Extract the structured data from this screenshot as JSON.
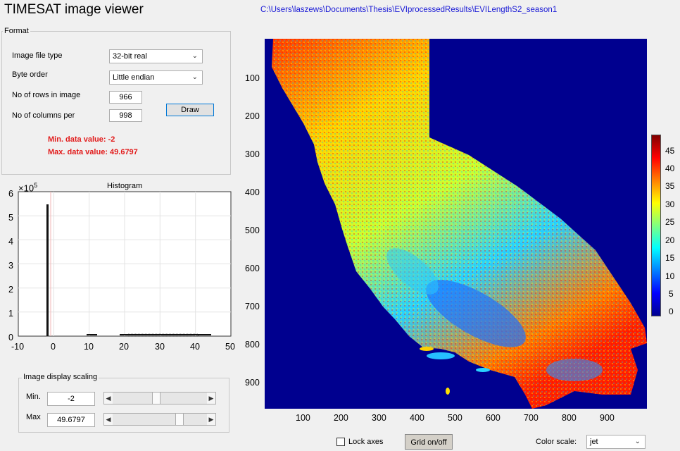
{
  "app": {
    "title": "TIMESAT image viewer",
    "file_path": "C:\\Users\\laszews\\Documents\\Thesis\\EVIprocessedResults\\EVILengthS2_season1"
  },
  "format": {
    "group_label": "Format",
    "file_type_label": "Image file type",
    "file_type_value": "32-bit real",
    "byte_order_label": "Byte order",
    "byte_order_value": "Little endian",
    "rows_label": "No of rows in image",
    "rows_value": "966",
    "cols_label": "No of columns per",
    "cols_value": "998",
    "draw_label": "Draw",
    "min_data": "Min. data value: -2",
    "max_data": "Max. data value: 49.6797"
  },
  "histogram": {
    "title": "Histogram",
    "exponent_base": "×10",
    "exponent_power": "5",
    "y_ticks": [
      "6",
      "5",
      "4",
      "3",
      "2",
      "1",
      "0"
    ],
    "x_ticks": [
      "-10",
      "0",
      "10",
      "20",
      "30",
      "40",
      "50"
    ]
  },
  "scaling": {
    "group_label": "Image display scaling",
    "min_label": "Min.",
    "min_value": "-2",
    "min_slider_fraction": 0.45,
    "max_label": "Max",
    "max_value": "49.6797",
    "max_slider_fraction": 0.72
  },
  "map": {
    "y_ticks": [
      "100",
      "200",
      "300",
      "400",
      "500",
      "600",
      "700",
      "800",
      "900"
    ],
    "x_ticks": [
      "100",
      "200",
      "300",
      "400",
      "500",
      "600",
      "700",
      "800",
      "900"
    ],
    "colorbar_ticks": [
      "45",
      "40",
      "35",
      "30",
      "25",
      "20",
      "15",
      "10",
      "5",
      "0"
    ],
    "colormap": "jet"
  },
  "controls": {
    "lock_axes_label": "Lock axes",
    "lock_axes_checked": false,
    "grid_label": "Grid on/off",
    "color_scale_label": "Color scale:",
    "color_scale_value": "jet"
  },
  "colors": {
    "background": "#f0f0f0",
    "path_text": "#1b1bd6",
    "data_red": "#e21b1b",
    "map_background": "#00008f"
  }
}
